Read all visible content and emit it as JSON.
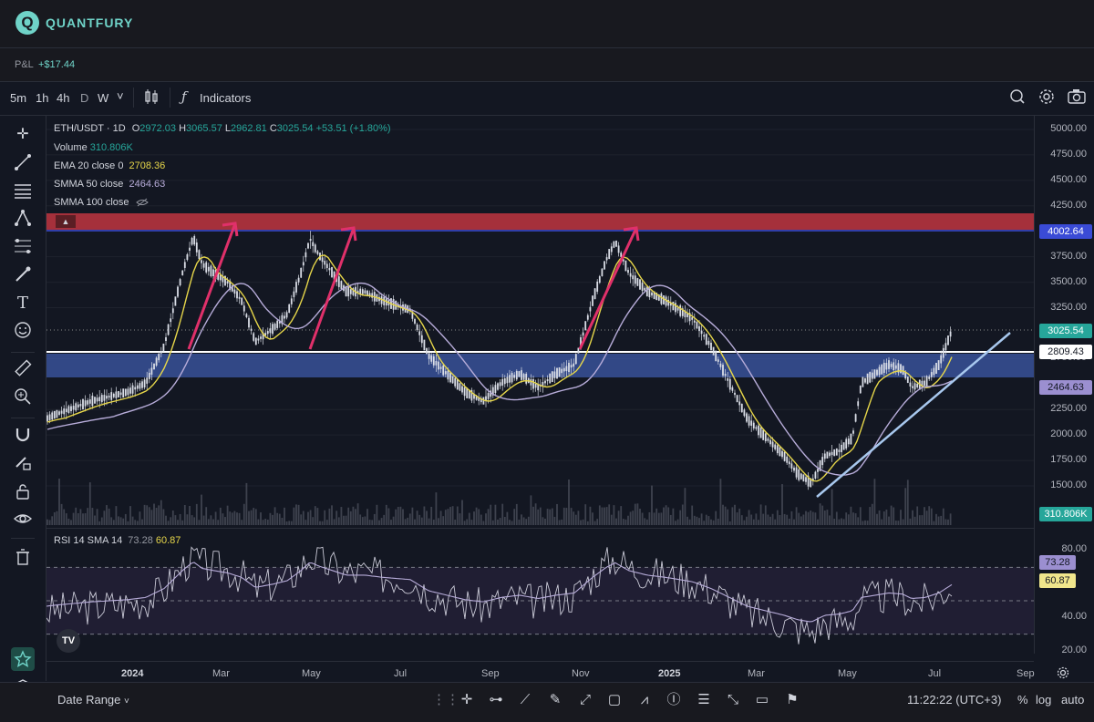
{
  "app": {
    "brand": "QUANTFURY",
    "logo_letter": "Q"
  },
  "pnl": {
    "label": "P&L",
    "value": "+$17.44"
  },
  "toolbar": {
    "timeframes": [
      "5m",
      "1h",
      "4h",
      "D",
      "W"
    ],
    "active_timeframe": "D",
    "dropdown_glyph": "˅",
    "indicators_label": "Indicators"
  },
  "legend": {
    "symbol": "ETH/USDT · 1D",
    "o_label": "O",
    "o": "2972.03",
    "h_label": "H",
    "h": "3065.57",
    "l_label": "L",
    "l": "2962.81",
    "c_label": "C",
    "c": "3025.54",
    "change": "+53.51 (+1.80%)",
    "volume_label": "Volume",
    "volume": "310.806K",
    "ema_label": "EMA 20 close 0",
    "ema": "2708.36",
    "smma50_label": "SMMA 50 close",
    "smma50": "2464.63",
    "smma100_label": "SMMA 100 close",
    "rsi_label": "RSI 14 SMA 14",
    "rsi": "73.28",
    "rsi_sma": "60.87"
  },
  "price_axis": {
    "ticks": [
      "5000.00",
      "4750.00",
      "4500.00",
      "4250.00",
      "3750.00",
      "3500.00",
      "3250.00",
      "2750.00",
      "2250.00",
      "2000.00",
      "1750.00",
      "1500.00"
    ],
    "tags": [
      {
        "value": "4002.64",
        "color": "#3a4bd6"
      },
      {
        "value": "3025.54",
        "color": "#26a69a"
      },
      {
        "value": "2809.43",
        "color": "#ffffff"
      },
      {
        "value": "2464.63",
        "color": "#9b8fd0"
      },
      {
        "value": "310.806K",
        "color": "#26a69a"
      }
    ],
    "rsi_ticks": [
      "80.00",
      "40.00",
      "20.00"
    ],
    "rsi_tags": [
      {
        "value": "73.28",
        "color": "#9b8fd0"
      },
      {
        "value": "60.87",
        "color": "#f0e68c"
      }
    ]
  },
  "time_axis": {
    "labels": [
      "2024",
      "Mar",
      "May",
      "Jul",
      "Sep",
      "Nov",
      "2025",
      "Mar",
      "May",
      "Jul",
      "Sep"
    ]
  },
  "bottom": {
    "date_range_label": "Date Range",
    "dropdown_glyph": "˅",
    "clock": "11:22:22 (UTC+3)",
    "percent": "%",
    "log": "log",
    "auto": "auto"
  },
  "watermark": "TV",
  "colors": {
    "accent": "#6fd3c8",
    "resistance": "#c0353f",
    "support": "#3e5aa8",
    "ema": "#e6d64a",
    "smma": "#b7acd9",
    "rsi": "#c9c9d6",
    "arrows": "#e0306a",
    "trend": "#a8c8ee",
    "candle": "#d9dde6"
  },
  "icons": {
    "sidebar": [
      "crosshair-icon",
      "trendline-icon",
      "horizontal-lines-icon",
      "pitchfork-icon",
      "fib-icon",
      "brush-icon",
      "text-icon",
      "emoji-icon",
      "ruler-icon",
      "zoom-icon",
      "magnet-icon",
      "pencil-lock-icon",
      "lock-icon",
      "eye-icon",
      "trash-icon",
      "star-icon",
      "layers-icon"
    ]
  }
}
